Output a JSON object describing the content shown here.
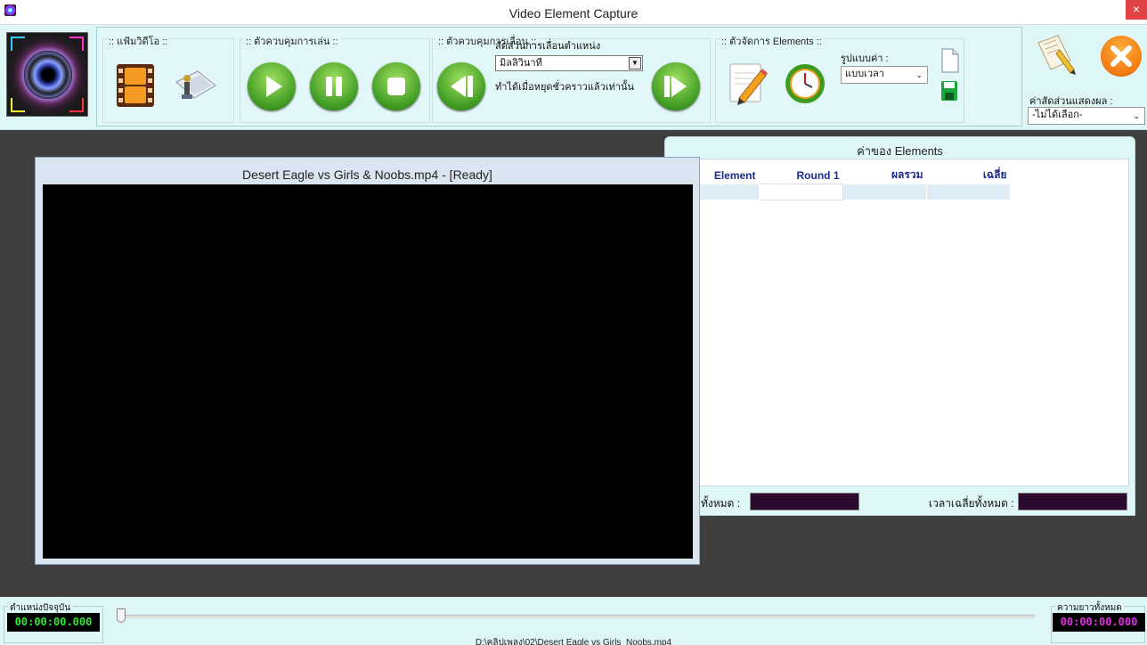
{
  "window": {
    "title": "Video Element Capture",
    "close_glyph": "×"
  },
  "groups": {
    "file": ":: แฟ้มวิดีโอ ::",
    "playback": ":: ตัวควบคุมการเล่น ::",
    "seek": ":: ตัวควบคุมการเลื่อน ::",
    "elements": ":: ตัวจัดการ Elements  ::"
  },
  "seek": {
    "ratio_label": "สัดส่วนการเลื่อนตำแหน่ง",
    "unit_value": "มิลลิวินาที",
    "note": "ทำได้เมื่อหยุดชั่วคราวแล้วเท่านั้น"
  },
  "elements_ctrl": {
    "format_label": "รูปแบบค่า :",
    "format_value": "แบบเวลา"
  },
  "display": {
    "ratio_label": "ค่าสัดส่วนแสดงผล :",
    "ratio_value": "-ไม่ได้เลือก-"
  },
  "values_panel": {
    "title": "ค่าของ Elements",
    "columns": [
      "Element",
      "Round 1",
      "ผลรวม",
      "เฉลี่ย"
    ],
    "total_label": "ทั้งหมด :",
    "avg_label": "เวลาเฉลี่ยทั้งหมด :"
  },
  "video": {
    "title": "Desert Eagle vs Girls & Noobs.mp4 - [Ready]"
  },
  "bottom": {
    "current_label": "ตำแหน่งปัจจุบัน",
    "current_time": "00:00:00.000",
    "duration_label": "ความยาวทั้งหมด",
    "duration_time": "00:00:00.000",
    "file_path": "D:\\คลิปเพลง\\02\\Desert Eagle vs Girls_Noobs.mp4"
  },
  "colors": {
    "current_time": "#2ee62e",
    "duration_time": "#e030e0",
    "header_text": "#1c2b8c"
  },
  "icons": [
    "app-icon",
    "logo-icon",
    "film-icon",
    "folder-icon",
    "play-icon",
    "pause-icon",
    "stop-icon",
    "seek-back-icon",
    "seek-forward-icon",
    "edit-icon",
    "clock-icon",
    "new-file-icon",
    "save-icon",
    "book-icon",
    "exit-icon"
  ]
}
